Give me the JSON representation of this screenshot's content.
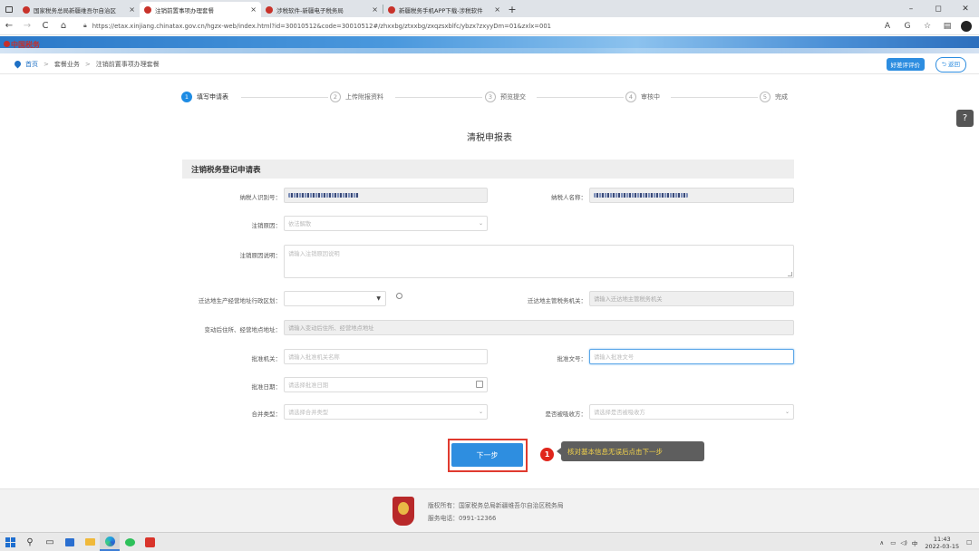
{
  "browser": {
    "tabs": [
      {
        "label": "国家税务总局新疆维吾尔自治区",
        "active": false
      },
      {
        "label": "注销前置事项办理套餐",
        "active": true
      },
      {
        "label": "涉税软件-新疆电子税务局",
        "active": false
      },
      {
        "label": "新疆税务手机APP下载-涉税软件",
        "active": false
      }
    ],
    "tab_close": "×",
    "new_tab": "+",
    "url": "https://etax.xinjiang.chinatax.gov.cn/hgzx-web/index.html?id=30010512&code=30010512#/zhxxbg/ztxxbg/zxqzsxblfc/ybzx?zxyyDm=01&zxlx=001",
    "nav": {
      "back": "←",
      "forward": "→",
      "refresh": "C",
      "home": "⌂"
    },
    "window_controls": {
      "minimize": "–",
      "maximize": "◻",
      "close": "✕"
    },
    "toolbar_icons": {
      "font": "A",
      "refresh": "G",
      "favorite": "☆",
      "collections": "▤"
    }
  },
  "banner": {
    "logo_text": "中国税务"
  },
  "breadcrumb": {
    "home": "首页",
    "sep": ">",
    "items": [
      "套餐业务",
      "注销前置事项办理套餐"
    ]
  },
  "header_actions": {
    "rating": "好差评评价",
    "back": "返回"
  },
  "help": {
    "label": "?"
  },
  "steps": [
    {
      "num": "1",
      "label": "填写申请表",
      "active": true
    },
    {
      "num": "2",
      "label": "上传附报资料",
      "active": false
    },
    {
      "num": "3",
      "label": "预览提交",
      "active": false
    },
    {
      "num": "4",
      "label": "审核中",
      "active": false
    },
    {
      "num": "5",
      "label": "完成",
      "active": false
    }
  ],
  "form": {
    "title": "清税申报表",
    "section": "注销税务登记申请表",
    "fields": {
      "taxpayer_id": {
        "label": "纳税人识别号："
      },
      "taxpayer_name": {
        "label": "纳税人名称："
      },
      "reason": {
        "label": "注销原因：",
        "value": "依法解散"
      },
      "reason_desc": {
        "label": "注销原因说明：",
        "placeholder": "请输入注销原因说明"
      },
      "move_region": {
        "label": "迁达地生产经营地址行政区划：",
        "value": ""
      },
      "move_tax_office": {
        "label": "迁达地主管税务机关：",
        "placeholder": "请输入迁达地主管税务机关"
      },
      "new_address": {
        "label": "变动后住所、经营地点地址：",
        "placeholder": "请输入变动后住所、经营地点地址"
      },
      "approval_org": {
        "label": "批准机关：",
        "placeholder": "请输入批准机关名称"
      },
      "approval_doc": {
        "label": "批准文号：",
        "placeholder": "请输入批准文号"
      },
      "approval_date": {
        "label": "批准日期：",
        "placeholder": "请选择批准日期"
      },
      "merge_type": {
        "label": "合并类型：",
        "placeholder": "请选择合并类型"
      },
      "absorbing_party": {
        "label": "是否被吸收方：",
        "placeholder": "请选择是否被吸收方"
      }
    },
    "next_button": "下一步"
  },
  "annotation": {
    "number": "1",
    "text": "核对基本信息无误后点击下一步"
  },
  "footer": {
    "copyright": "版权所有：国家税务总局新疆维吾尔自治区税务局",
    "phone": "服务电话：0991-12366"
  },
  "taskbar": {
    "search": "⚲",
    "tray": {
      "ime": "中",
      "time": "11:43",
      "date": "2022-03-15",
      "notifications": "☐"
    }
  }
}
